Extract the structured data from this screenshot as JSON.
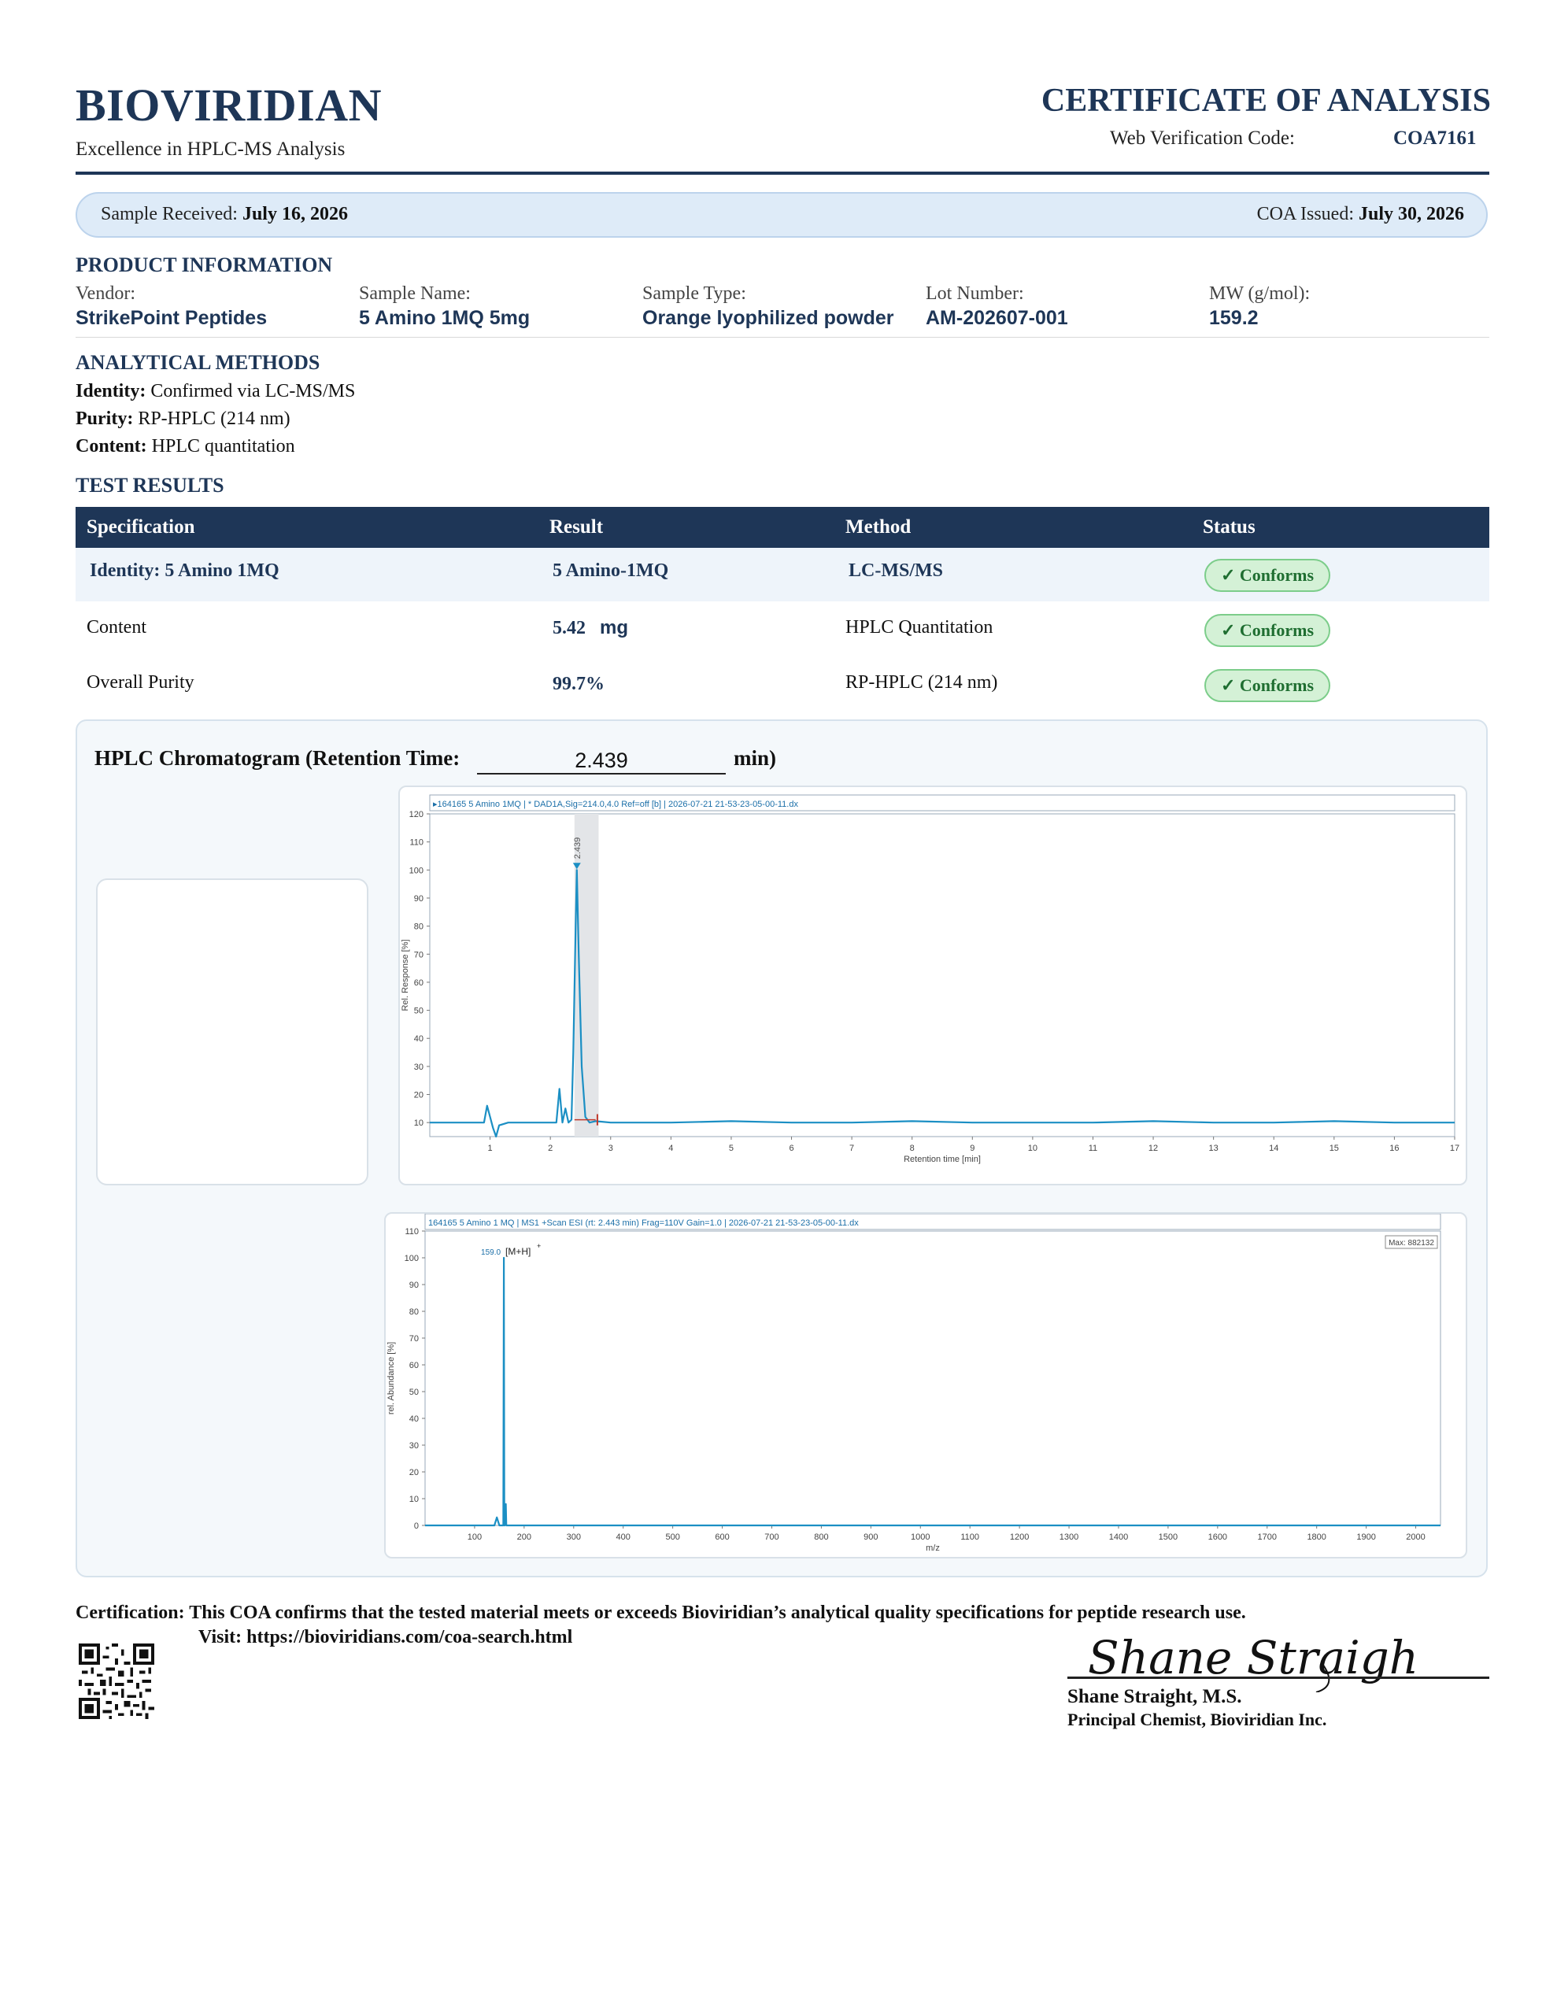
{
  "header": {
    "brand": "BIOVIRIDIAN",
    "tagline": "Excellence in HPLC-MS Analysis",
    "doc_title": "CERTIFICATE OF ANALYSIS",
    "verification_label": "Web Verification Code:",
    "verification_code": "COA7161"
  },
  "dates": {
    "received_label": "Sample Received:",
    "received_value": "July 16, 2026",
    "issued_label": "COA Issued:",
    "issued_value": "July 30, 2026"
  },
  "product_info": {
    "heading": "PRODUCT INFORMATION",
    "fields": [
      {
        "label": "Vendor:",
        "value": "StrikePoint Peptides"
      },
      {
        "label": "Sample Name:",
        "value": "5 Amino 1MQ 5mg"
      },
      {
        "label": "Sample Type:",
        "value": "Orange lyophilized powder"
      },
      {
        "label": "Lot Number:",
        "value": "AM-202607-001"
      },
      {
        "label": "MW (g/mol):",
        "value": "159.2"
      }
    ]
  },
  "analytical_methods": {
    "heading": "ANALYTICAL METHODS",
    "items": [
      {
        "label": "Identity:",
        "value": "Confirmed via LC-MS/MS"
      },
      {
        "label": "Purity:",
        "value": "RP-HPLC (214 nm)"
      },
      {
        "label": "Content:",
        "value": "HPLC quantitation"
      }
    ]
  },
  "test_results": {
    "heading": "TEST RESULTS",
    "columns": [
      "Specification",
      "Result",
      "Method",
      "Status"
    ],
    "rows": [
      {
        "spec": "Identity:  5 Amino 1MQ",
        "result": "5 Amino-1MQ",
        "method": "LC-MS/MS",
        "status": "✓ Conforms"
      },
      {
        "spec": "Content",
        "result": "5.42",
        "result_unit": "mg",
        "method": "HPLC Quantitation",
        "status": "✓ Conforms"
      },
      {
        "spec": "Overall Purity",
        "result": "99.7%",
        "method": "RP-HPLC (214 nm)",
        "status": "✓ Conforms"
      }
    ]
  },
  "chromatogram": {
    "title_prefix": "HPLC Chromatogram (Retention Time:",
    "retention_time": "2.439",
    "title_suffix": "min)"
  },
  "chart_data": [
    {
      "type": "line",
      "title": "▸164165 5 Amino 1MQ | * DAD1A,Sig=214.0,4.0 Ref=off [b] | 2026-07-21 21-53-23-05-00-11.dx",
      "xlabel": "Retention time [min]",
      "ylabel": "Rel. Response [%]",
      "xlim": [
        0,
        17
      ],
      "ylim": [
        5,
        120
      ],
      "xticks": [
        1,
        2,
        3,
        4,
        5,
        6,
        7,
        8,
        9,
        10,
        11,
        12,
        13,
        14,
        15,
        16,
        17
      ],
      "yticks": [
        10,
        20,
        30,
        40,
        50,
        60,
        70,
        80,
        90,
        100,
        110,
        120
      ],
      "peak_label": "2.439",
      "highlight_window": [
        2.4,
        2.8
      ],
      "line_color": "#1b8fc4",
      "x": [
        0,
        0.9,
        0.95,
        1.0,
        1.05,
        1.1,
        1.15,
        1.3,
        1.5,
        1.9,
        2.1,
        2.15,
        2.2,
        2.25,
        2.3,
        2.35,
        2.38,
        2.42,
        2.439,
        2.47,
        2.52,
        2.58,
        2.65,
        2.75,
        3.0,
        4.0,
        5.0,
        6.0,
        7.0,
        8.0,
        9.0,
        10.0,
        11.0,
        12.0,
        13.0,
        14.0,
        15.0,
        16.0,
        17.0
      ],
      "y": [
        10,
        10,
        16,
        12,
        8,
        5,
        9,
        10,
        10,
        10,
        10,
        22,
        10,
        15,
        10,
        11,
        35,
        80,
        100,
        70,
        30,
        12,
        10,
        10.5,
        10,
        10,
        10.5,
        10,
        10,
        10.5,
        10,
        10,
        10,
        10.5,
        10,
        10,
        10.5,
        10,
        10
      ]
    },
    {
      "type": "line",
      "title": "164165 5 Amino 1 MQ | MS1 +Scan ESI (rt: 2.443 min) Frag=110V Gain=1.0 | 2026-07-21 21-53-23-05-00-11.dx",
      "xlabel": "m/z",
      "ylabel": "rel. Abundance [%]",
      "xlim": [
        0,
        2050
      ],
      "ylim": [
        0,
        110
      ],
      "xticks": [
        100,
        200,
        300,
        400,
        500,
        600,
        700,
        800,
        900,
        1000,
        1100,
        1200,
        1300,
        1400,
        1500,
        1600,
        1700,
        1800,
        1900,
        2000
      ],
      "yticks": [
        0,
        10,
        20,
        30,
        40,
        50,
        60,
        70,
        80,
        90,
        100,
        110
      ],
      "peak_mz": "159.0",
      "peak_annotation": "[M+H]",
      "peak_annotation_sup": "+",
      "max_label": "Max: 882132",
      "line_color": "#1b8fc4",
      "x": [
        0,
        140,
        145,
        150,
        155,
        158,
        159,
        160,
        161,
        163,
        164,
        165,
        170,
        2050
      ],
      "y": [
        0,
        0,
        3,
        0,
        0,
        0,
        100,
        0,
        0,
        8,
        0,
        0,
        0,
        0
      ]
    }
  ],
  "certification": {
    "label": "Certification:",
    "text": "This COA confirms that the tested material meets or exceeds Bioviridian’s analytical quality specifications for peptide research use.",
    "visit_label": "Visit:",
    "visit_url": "https://bioviridians.com/coa-search.html"
  },
  "signatory": {
    "signature": "Shane Straight",
    "name": "Shane Straight, M.S.",
    "title": "Principal Chemist, Bioviridian Inc."
  },
  "colors": {
    "navy": "#1e3657",
    "badge_green": "#d4f1d6",
    "line_blue": "#1b8fc4"
  }
}
